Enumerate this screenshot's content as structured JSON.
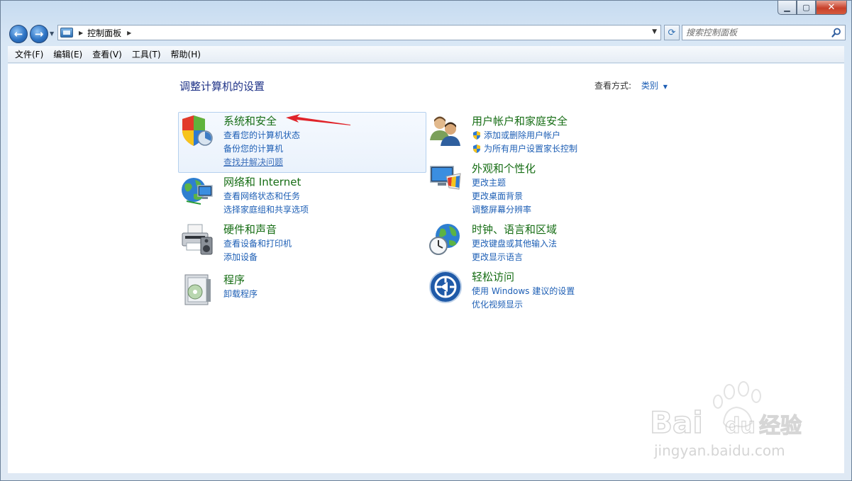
{
  "breadcrumb": {
    "root": "控制面板"
  },
  "search": {
    "placeholder": "搜索控制面板"
  },
  "menu": [
    {
      "label": "文件(F)"
    },
    {
      "label": "编辑(E)"
    },
    {
      "label": "查看(V)"
    },
    {
      "label": "工具(T)"
    },
    {
      "label": "帮助(H)"
    }
  ],
  "page": {
    "title": "调整计算机的设置",
    "view_by_label": "查看方式:",
    "view_by_value": "类别"
  },
  "categories": [
    {
      "title": "系统和安全",
      "icon": "shield-icon",
      "links": [
        "查看您的计算机状态",
        "备份您的计算机",
        "查找并解决问题"
      ]
    },
    {
      "title": "网络和 Internet",
      "icon": "network-icon",
      "links": [
        "查看网络状态和任务",
        "选择家庭组和共享选项"
      ]
    },
    {
      "title": "硬件和声音",
      "icon": "printer-icon",
      "links": [
        "查看设备和打印机",
        "添加设备"
      ]
    },
    {
      "title": "程序",
      "icon": "programs-icon",
      "links": [
        "卸载程序"
      ]
    },
    {
      "title": "用户帐户和家庭安全",
      "icon": "users-icon",
      "links": [
        "添加或删除用户帐户",
        "为所有用户设置家长控制"
      ]
    },
    {
      "title": "外观和个性化",
      "icon": "display-icon",
      "links": [
        "更改主题",
        "更改桌面背景",
        "调整屏幕分辨率"
      ]
    },
    {
      "title": "时钟、语言和区域",
      "icon": "globe-clock-icon",
      "links": [
        "更改键盘或其他输入法",
        "更改显示语言"
      ]
    },
    {
      "title": "轻松访问",
      "icon": "ease-of-access-icon",
      "links": [
        "使用 Windows 建议的设置",
        "优化视频显示"
      ]
    }
  ],
  "watermark": {
    "text": "Bai du 经验",
    "url": "jingyan.baidu.com"
  },
  "colors": {
    "link": "#1e5fb5",
    "category_title": "#166d14",
    "page_title": "#1e3287",
    "annotation_arrow": "#e0242a"
  }
}
